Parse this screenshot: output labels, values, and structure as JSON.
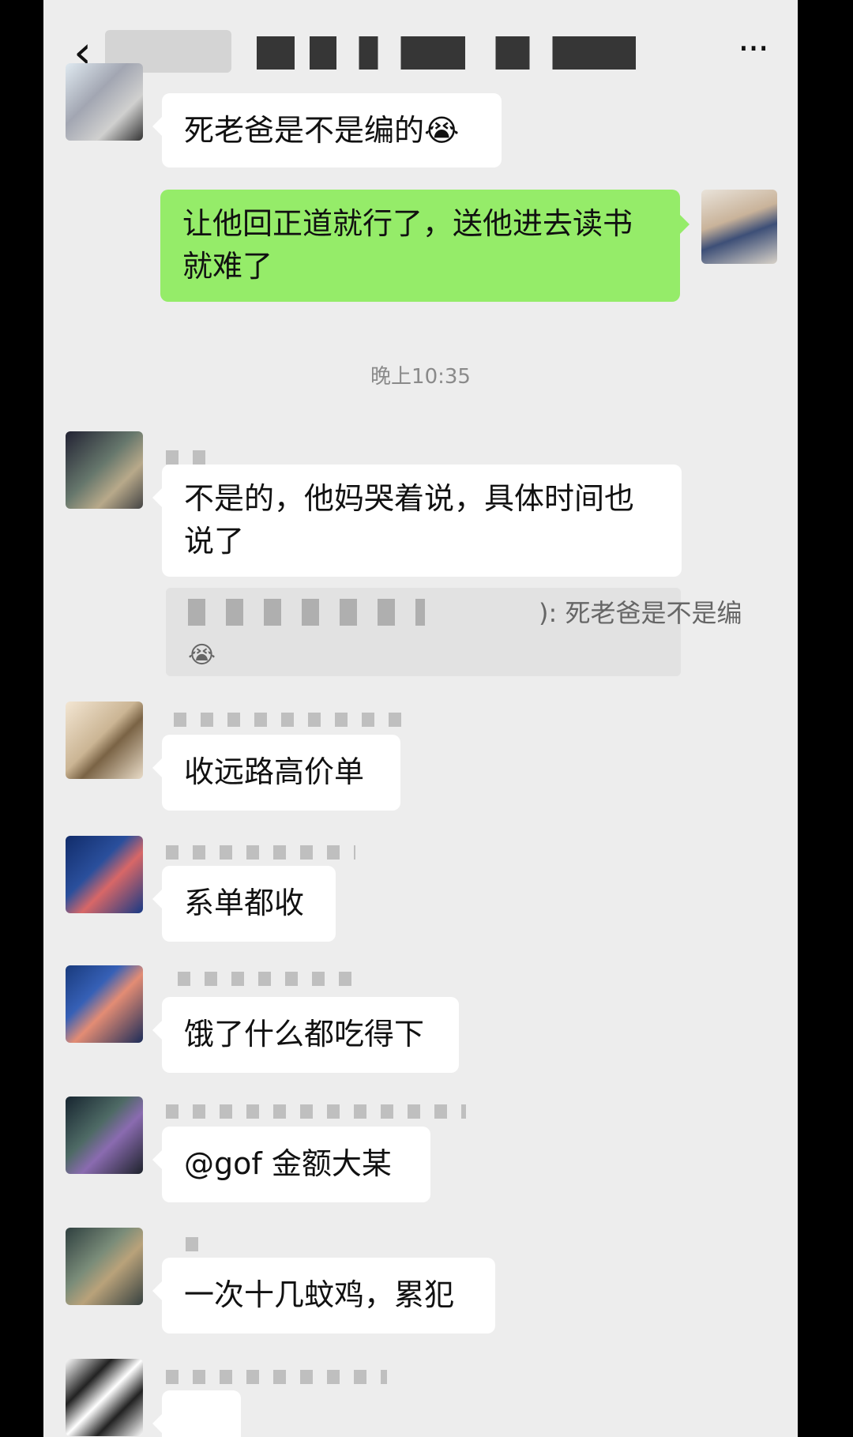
{
  "header": {
    "back_icon": "chevron-left-icon",
    "more_icon": "more-horizontal-icon"
  },
  "messages": {
    "m1": "死老爸是不是编的😭",
    "m2_line1": "让他回正道就行了，送他进去读书",
    "m2_line2": "就难了",
    "timestamp": "晚上10:35",
    "m3_line1": "不是的，他妈哭着说，具体时间也",
    "m3_line2": "说了",
    "quote_text": "):  死老爸是不是编",
    "quote_emoji": "😭",
    "m4": "收远路高价单",
    "m5": "系单都收",
    "m6": "饿了什么都吃得下",
    "m7": "@gof  金额大某",
    "m8": "一次十几蚊鸡，累犯"
  }
}
